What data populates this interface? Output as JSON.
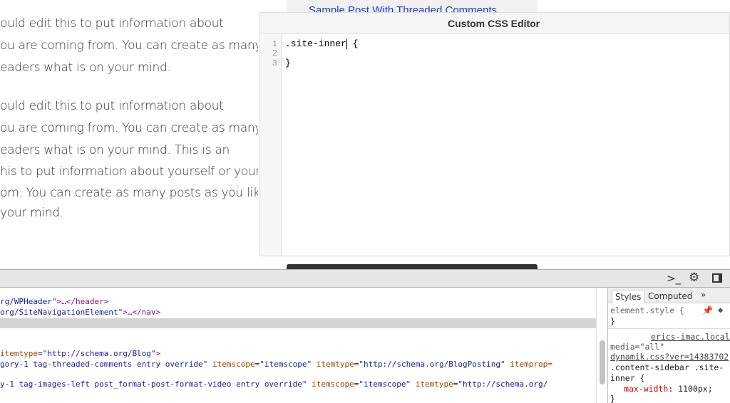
{
  "page": {
    "paragraph1": [
      "ould edit this to put information about",
      "ou are coming from. You can create as many",
      "eaders what is on your mind."
    ],
    "paragraph2": [
      "ould edit this to put information about",
      "ou are coming from. You can create as many",
      "eaders what is on your mind. This is an",
      "his to put information about yourself or your",
      "om. You can create as many posts as you like",
      " your mind."
    ],
    "top_link": "Sample Post With Threaded Comments"
  },
  "editor": {
    "title": "Custom CSS Editor",
    "line_numbers": [
      "1",
      "2",
      "3"
    ],
    "lines": [
      ".site-inner",
      "",
      " {",
      "}"
    ]
  },
  "devtools": {
    "toolbar_icons": [
      "console-drawer-icon",
      "settings-gear-icon",
      "dock-side-icon"
    ],
    "elements": {
      "row1": {
        "a": "rg/WPHeader\"",
        "b": ">…</header>"
      },
      "row2": {
        "a": "org/SiteNavigationElement\"",
        "b": ">…</nav>"
      },
      "row3": {
        "an": "itemtype",
        "av": "\"http://schema.org/Blog\"",
        "end": ">"
      },
      "row4": {
        "cls": "gory-1 tag-threaded-comments entry override\"",
        "an1": "itemscope",
        "av1": "\"itemscope\"",
        "an2": "itemtype",
        "av2": "\"http://schema.org/BlogPosting\"",
        "an3": "itemprop="
      },
      "row5": {
        "cls": "y-1 tag-images-left post_format-post-format-video entry override\"",
        "an1": "itemscope",
        "av1": "\"itemscope\"",
        "an2": "itemtype",
        "av2": "\"http://schema.org/"
      }
    },
    "sidebar": {
      "tabs": [
        "Styles",
        "Computed",
        "»"
      ],
      "element_style": "element.style {",
      "close": "}",
      "source": "erics-imac.local/",
      "media": "media=\"all\"",
      "file": "dynamik.css?ver=14383702",
      "selector1": ".content-sidebar .site-",
      "selector2": "inner {",
      "property": "max-width",
      "value": ": 1100px;",
      "rule_close": "}"
    }
  }
}
